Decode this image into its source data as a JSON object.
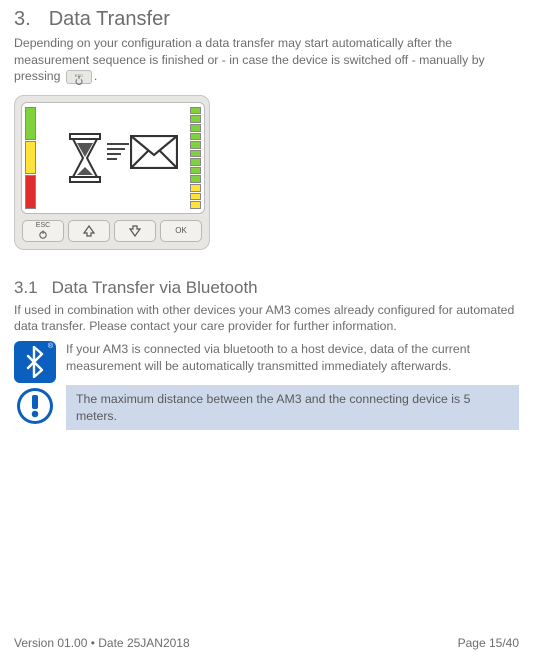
{
  "section": {
    "number": "3.",
    "title": "Data Transfer",
    "intro1": "Depending on your configuration a data transfer may start automatically after the measurement sequence is finished  or - in case the device is switched off - manually by pressing ",
    "intro2": "."
  },
  "buttons": {
    "esc": "ESC",
    "ok": "OK"
  },
  "subsection": {
    "number": "3.1",
    "title": "Data Transfer via Bluetooth",
    "intro": "If used in combination with other devices your AM3 comes already configured for automated data transfer. Please contact your care provider for further information.",
    "bt_note": "If your AM3 is connected via bluetooth to a host device, data of the current measurement will be automatically transmitted immediately afterwards.",
    "warn": "The maximum distance between the AM3 and the connecting device is 5 meters."
  },
  "footer": {
    "version": "Version 01.00 • Date 25JAN2018",
    "page": "Page 15/40"
  }
}
